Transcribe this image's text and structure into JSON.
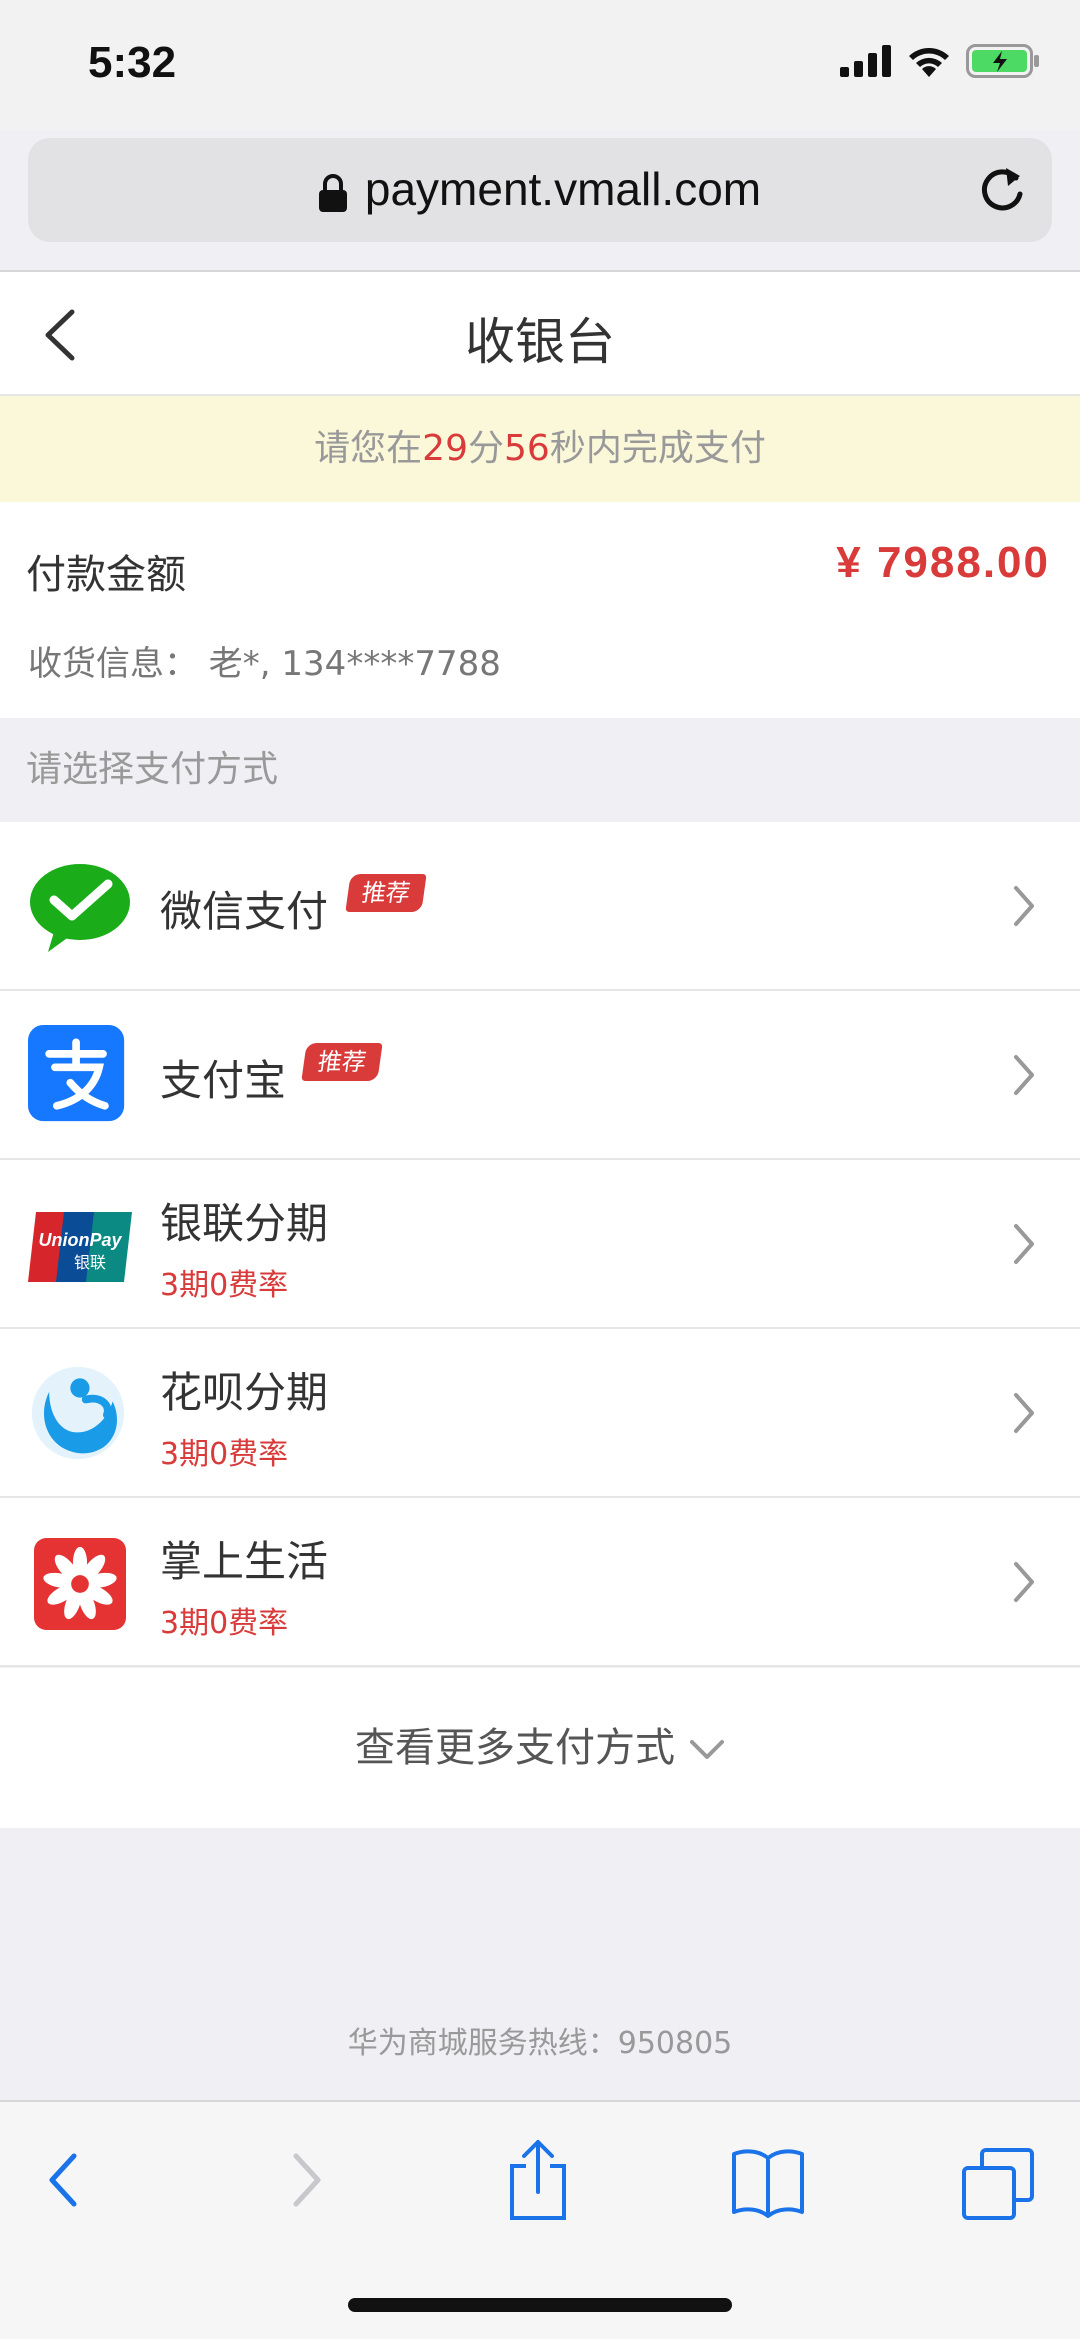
{
  "status_bar": {
    "time": "5:32"
  },
  "browser": {
    "url": "payment.vmall.com"
  },
  "header": {
    "title": "收银台"
  },
  "timer": {
    "prefix": "请您在",
    "minutes": "29",
    "min_unit": "分",
    "seconds": "56",
    "suffix": "秒内完成支付"
  },
  "amount": {
    "label": "付款金额",
    "value": "¥ 7988.00"
  },
  "shipping": {
    "text": "收货信息：  老*, 134****7788"
  },
  "section_title": "请选择支付方式",
  "payment_methods": [
    {
      "name": "微信支付",
      "badge": "推荐",
      "sub": ""
    },
    {
      "name": "支付宝",
      "badge": "推荐",
      "sub": ""
    },
    {
      "name": "银联分期",
      "badge": "",
      "sub": "3期0费率"
    },
    {
      "name": "花呗分期",
      "badge": "",
      "sub": "3期0费率"
    },
    {
      "name": "掌上生活",
      "badge": "",
      "sub": "3期0费率"
    }
  ],
  "unionpay_logo": {
    "text1": "UnionPay",
    "text2": "银联"
  },
  "more_label": "查看更多支付方式",
  "hotline": "华为商城服务热线：950805",
  "colors": {
    "accent_red": "#d93a3a",
    "wechat_green": "#1aad19",
    "alipay_blue": "#1677ff"
  }
}
